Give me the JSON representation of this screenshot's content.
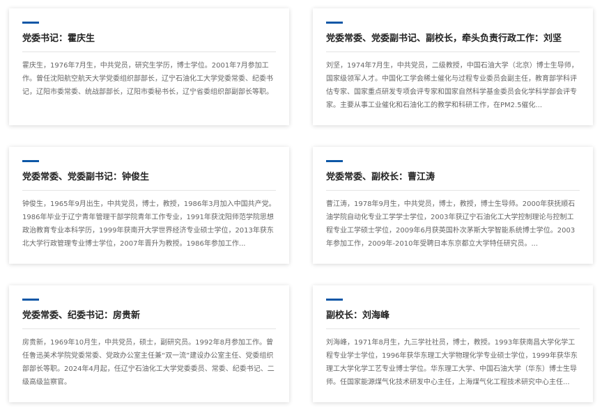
{
  "leaders": [
    {
      "title": "党委书记：霍庆生",
      "desc": "霍庆生，1976年7月生，中共党员，研究生学历，博士学位。2001年7月参加工作。曾任沈阳航空航天大学党委组织部部长，辽宁石油化工大学党委常委、纪委书记，辽阳市委常委、统战部部长，辽阳市委秘书长，辽宁省委组织部副部长等职。"
    },
    {
      "title": "党委常委、党委副书记、副校长，牵头负责行政工作：刘坚",
      "desc": "刘坚，1974年7月生，中共党员，二级教授，中国石油大学（北京）博士生导师，国家级领军人才。中国化工学会稀土催化与过程专业委员会副主任，教育部学科评估专家、国家重点研发专项会评专家和国家自然科学基金委员会化学科学部会评专家。主要从事工业催化和石油化工的教学和科研工作，在PM2.5催化..."
    },
    {
      "title": "党委常委、党委副书记：钟俊生",
      "desc": "钟俊生，1965年9月出生，中共党员，博士，教授，1986年3月加入中国共产党。1986年毕业于辽宁青年管理干部学院青年工作专业，1991年获沈阳师范学院思想政治教育专业本科学历，1999年获南开大学世界经济专业硕士学位，2013年获东北大学行政管理专业博士学位，2007年晋升为教授。1986年参加工作..."
    },
    {
      "title": "党委常委、副校长：曹江涛",
      "desc": "曹江涛，1978年9月生，中共党员，博士，教授，博士生导师。2000年获抚顺石油学院自动化专业工学学士学位，2003年获辽宁石油化工大学控制理论与控制工程专业工学硕士学位，2009年6月获英国朴次茅斯大学智能系统博士学位。2003年参加工作，2009年-2010年受聘日本东京都立大学特任研究员。..."
    },
    {
      "title": "党委常委、纪委书记：房贵新",
      "desc": "房贵新，1969年10月生，中共党员，硕士，副研究员。1992年8月参加工作。曾任鲁迅美术学院党委常委、党政办公室主任兼“双一流”建设办公室主任、党委组织部部长等职。2024年4月起，任辽宁石油化工大学党委委员、常委、纪委书记、二级高级监察官。"
    },
    {
      "title": "副校长：刘海峰",
      "desc": "刘海峰，1971年8月生，九三学社社员，博士，教授。1993年获南昌大学化学工程专业学士学位，1996年获华东理工大学物理化学专业硕士学位，1999年获华东理工大学化学工艺专业博士学位。华东理工大学、中国石油大学（华东）博士生导师。任国家能源煤气化技术研发中心主任，上海煤气化工程技术研究中心主任..."
    }
  ],
  "colors": {
    "accent": "#0d57a6"
  }
}
